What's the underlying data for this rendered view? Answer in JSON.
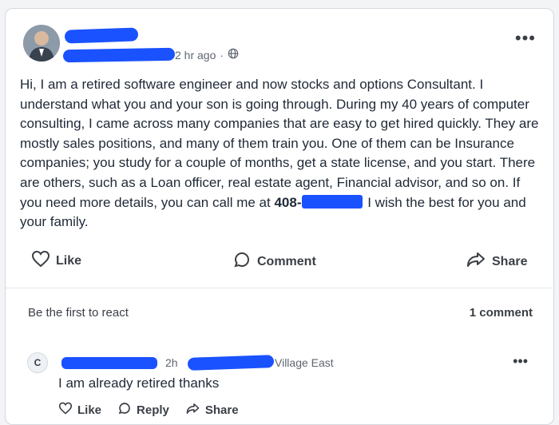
{
  "post": {
    "time": "2 hr ago",
    "visibility_icon": "globe-icon",
    "more_icon": "more-horizontal-icon",
    "body_main": "Hi, I am a retired software engineer and now stocks and options Consultant. I understand what you and your son is going through. During my 40 years of computer consulting, I came across many companies that are easy to get hired quickly. They are mostly sales positions, and many of them train you. One of them can be Insurance companies; you study for a couple of months, get a state license, and you start. There are others, such as a Loan officer, real estate agent, Financial advisor, and so on. If you need more details, you can call me at",
    "phone_prefix": "408-",
    "body_end": "I wish the best for you and your family."
  },
  "actions": {
    "like": "Like",
    "comment": "Comment",
    "share": "Share"
  },
  "reactions": {
    "first_react": "Be the first to react",
    "comments_count": "1 comment"
  },
  "comment": {
    "avatar_letter": "C",
    "time": "2h",
    "location": "Village East",
    "text": "I am already retired thanks",
    "like": "Like",
    "reply": "Reply",
    "share": "Share"
  },
  "colors": {
    "redaction": "#1a52ff",
    "text": "#1f2937",
    "muted": "#5f6670"
  }
}
